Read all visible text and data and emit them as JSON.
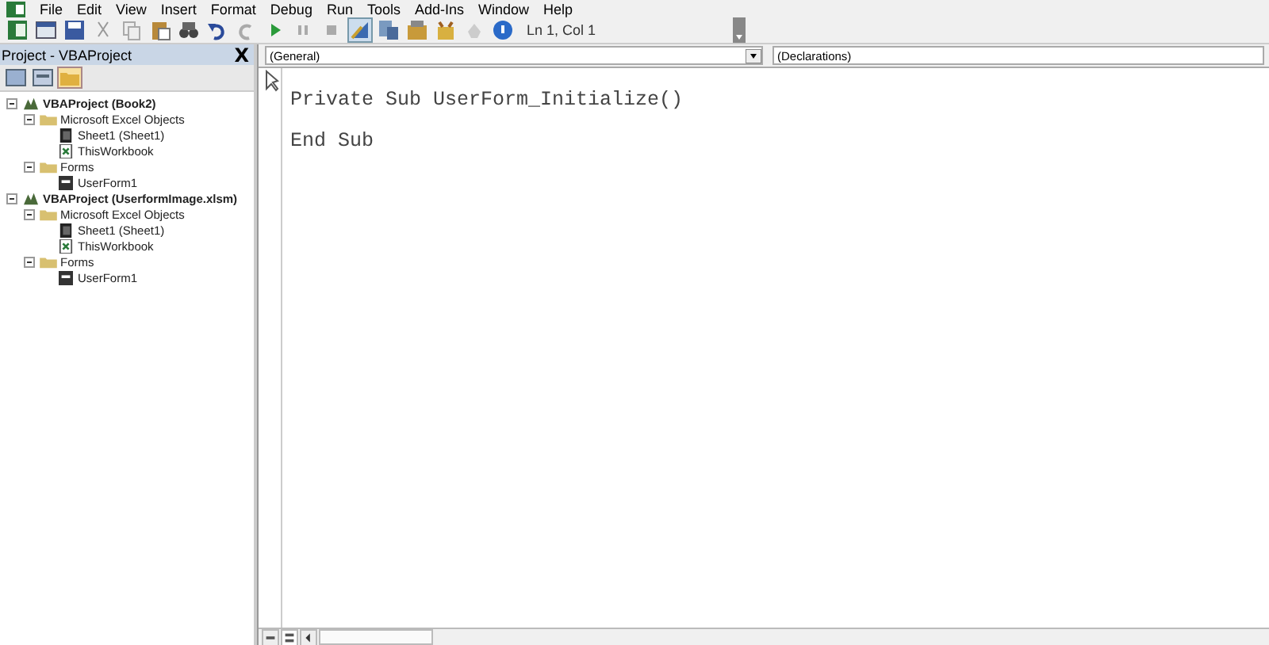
{
  "menu": [
    "File",
    "Edit",
    "View",
    "Insert",
    "Format",
    "Debug",
    "Run",
    "Tools",
    "Add-Ins",
    "Window",
    "Help"
  ],
  "toolbar": {
    "position": "Ln 1, Col 1"
  },
  "project_panel": {
    "title": "Project - VBAProject",
    "close": "X",
    "tree": [
      {
        "label": "VBAProject (Book2)",
        "kind": "project",
        "expanded": true,
        "children": [
          {
            "label": "Microsoft Excel Objects",
            "kind": "folder",
            "expanded": true,
            "children": [
              {
                "label": "Sheet1 (Sheet1)",
                "kind": "sheet"
              },
              {
                "label": "ThisWorkbook",
                "kind": "workbook"
              }
            ]
          },
          {
            "label": "Forms",
            "kind": "folder",
            "expanded": true,
            "children": [
              {
                "label": "UserForm1",
                "kind": "form"
              }
            ]
          }
        ]
      },
      {
        "label": "VBAProject (UserformImage.xlsm)",
        "kind": "project",
        "expanded": true,
        "children": [
          {
            "label": "Microsoft Excel Objects",
            "kind": "folder",
            "expanded": true,
            "children": [
              {
                "label": "Sheet1 (Sheet1)",
                "kind": "sheet"
              },
              {
                "label": "ThisWorkbook",
                "kind": "workbook"
              }
            ]
          },
          {
            "label": "Forms",
            "kind": "folder",
            "expanded": true,
            "children": [
              {
                "label": "UserForm1",
                "kind": "form"
              }
            ]
          }
        ]
      }
    ]
  },
  "code_window": {
    "object": "(General)",
    "procedure": "(Declarations)",
    "lines": [
      "Private Sub UserForm_Initialize()",
      "End Sub"
    ]
  }
}
